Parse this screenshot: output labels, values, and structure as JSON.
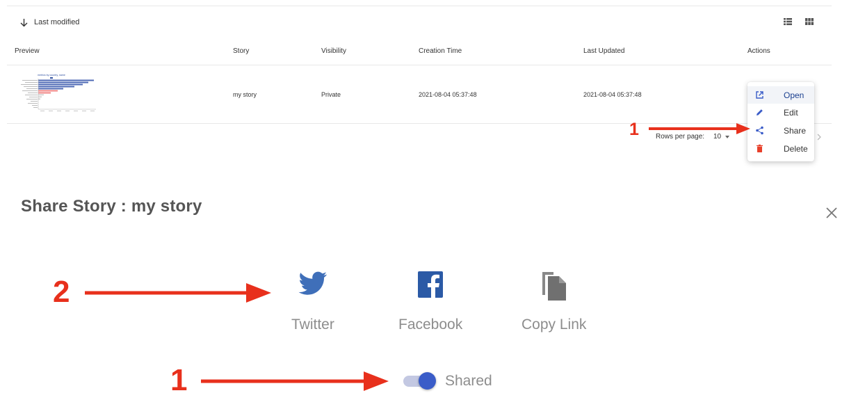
{
  "toolbar": {
    "sort_label": "Last modified"
  },
  "table": {
    "headers": [
      "Preview",
      "Story",
      "Visibility",
      "Creation Time",
      "Last Updated",
      "Actions"
    ],
    "rows": [
      {
        "preview_title": "metrics by country, name",
        "story": "my story",
        "visibility": "Private",
        "creation_time": "2021-08-04 05:37:48",
        "last_updated": "2021-08-04 05:37:48"
      }
    ]
  },
  "pagination": {
    "rows_per_page_label": "Rows per page:",
    "rows_per_page_value": "10"
  },
  "action_menu": {
    "items": [
      {
        "label": "Open",
        "icon": "open-in-new-icon"
      },
      {
        "label": "Edit",
        "icon": "pencil-icon"
      },
      {
        "label": "Share",
        "icon": "share-icon"
      },
      {
        "label": "Delete",
        "icon": "trash-icon"
      }
    ]
  },
  "dialog": {
    "title": "Share Story : my story",
    "options": [
      {
        "label": "Twitter",
        "icon": "twitter-icon"
      },
      {
        "label": "Facebook",
        "icon": "facebook-icon"
      },
      {
        "label": "Copy Link",
        "icon": "copy-icon"
      }
    ],
    "toggle": {
      "label": "Shared",
      "on": true
    }
  },
  "annotations": {
    "menu_step": "1",
    "options_step": "2",
    "toggle_step": "1"
  },
  "colors": {
    "accent": "#3a5cc8",
    "annotation": "#e8301c",
    "delete": "#e8402a",
    "twitter": "#3f6fb9",
    "facebook": "#2b5aa6"
  }
}
